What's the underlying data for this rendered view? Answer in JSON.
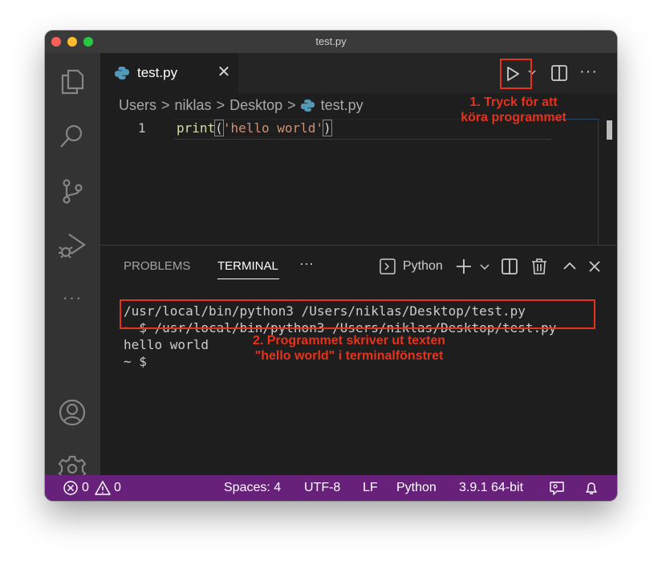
{
  "window": {
    "title": "test.py"
  },
  "activity_bar": {
    "items": [
      "explorer-icon",
      "search-icon",
      "source-control-icon",
      "run-debug-icon",
      "more-icon",
      "account-icon",
      "settings-gear-icon"
    ],
    "more_label": "···"
  },
  "editor": {
    "tab": {
      "label": "test.py",
      "close": "✕"
    },
    "actions": {
      "more": "···"
    },
    "breadcrumb": [
      "Users",
      "niklas",
      "Desktop",
      "test.py"
    ],
    "breadcrumb_sep": ">",
    "lines": [
      {
        "number": "1",
        "fn": "print",
        "open": "(",
        "string": "'hello world'",
        "close": ")"
      }
    ]
  },
  "panel": {
    "tabs": [
      "PROBLEMS",
      "TERMINAL"
    ],
    "active_tab": "TERMINAL",
    "more": "···",
    "terminal_name": "Python",
    "terminal_lines": [
      "/usr/local/bin/python3 /Users/niklas/Desktop/test.py",
      "~ $ /usr/local/bin/python3 /Users/niklas/Desktop/test.py",
      "hello world",
      "~ $ "
    ]
  },
  "annotations": [
    {
      "text_line1": "1. Tryck för att",
      "text_line2": "köra programmet"
    },
    {
      "text_line1": "2. Programmet skriver ut texten",
      "text_line2": "\"hello world\" i terminalfönstret"
    }
  ],
  "statusbar": {
    "errors": "0",
    "warnings": "0",
    "spaces": "Spaces: 4",
    "encoding": "UTF-8",
    "eol": "LF",
    "language": "Python",
    "interpreter": "3.9.1 64-bit",
    "color": "#68217a"
  },
  "colors": {
    "annotation": "#e8321c",
    "editor_bg": "#1e1e1e",
    "activity_bg": "#333333"
  }
}
